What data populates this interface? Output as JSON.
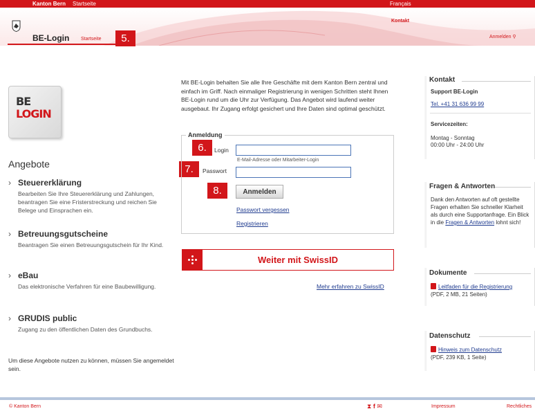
{
  "topbar": {
    "left_title": "Kanton Bern",
    "left_home": "Startseite",
    "language": "Français"
  },
  "header": {
    "kontakt": "Kontakt",
    "anmelden": "Anmelden",
    "brand": "BE-Login",
    "startseite": "Startseite"
  },
  "steps": {
    "s5": "5.",
    "s6": "6.",
    "s7": "7.",
    "s8": "8."
  },
  "logo": {
    "line1": "BE",
    "line2": "LOGIN"
  },
  "left": {
    "angebote_title": "Angebote",
    "offers": [
      {
        "title": "Steuererklärung",
        "desc": "Bearbeiten Sie Ihre Steuererklärung und Zahlungen, beantragen Sie eine Fristerstreckung und reichen Sie Belege und Einsprachen ein."
      },
      {
        "title": "Betreuungsgutscheine",
        "desc": "Beantragen Sie einen Betreuungsgutschein für Ihr Kind."
      },
      {
        "title": "eBau",
        "desc": "Das elektronische Verfahren für eine Baubewilligung."
      },
      {
        "title": "GRUDIS public",
        "desc": "Zugang zu den öffentlichen Daten des Grundbuchs."
      }
    ],
    "footnote": "Um diese Angebote nutzen zu können, müssen Sie angemeldet sein."
  },
  "main": {
    "intro": "Mit BE-Login behalten Sie alle Ihre Geschäfte mit dem Kanton Bern zentral und einfach im Griff. Nach einmaliger Registrierung in wenigen Schritten steht Ihnen BE-Login rund um die Uhr zur Verfügung. Das Angebot wird laufend weiter ausgebaut. Ihr Zugang erfolgt gesichert und Ihre Daten sind optimal geschützt.",
    "legend": "Anmeldung",
    "login_label": "Login",
    "login_value": "",
    "login_hint": "E-Mail-Adresse oder Mitarbeiter-Login",
    "password_label": "Passwort",
    "password_value": "",
    "submit": "Anmelden",
    "forgot": "Passwort vergessen",
    "register": "Registrieren",
    "swissid": "Weiter mit SwissID",
    "swissid_more": "Mehr erfahren zu SwissID"
  },
  "right": {
    "kontakt": {
      "title": "Kontakt",
      "support": "Support BE-Login",
      "phone": "Tel. +41 31 636 99 99",
      "service_title": "Servicezeiten:",
      "service_days": "Montag - Sonntag",
      "service_hours": "00:00 Uhr - 24:00 Uhr"
    },
    "faq": {
      "title": "Fragen & Antworten",
      "text": "Dank den Antworten auf oft gestellte Fragen erhalten Sie schneller Klarheit als durch eine Supportanfrage. Ein Blick in die",
      "link": "Fragen & Antworten",
      "text_end": "lohnt sich!"
    },
    "dokumente": {
      "title": "Dokumente",
      "link": "Leitfaden für die Registrierung",
      "meta": "(PDF, 2 MB, 21 Seiten)"
    },
    "datenschutz": {
      "title": "Datenschutz",
      "link": "Hinweis zum Datenschutz",
      "meta": "(PDF, 239 KB, 1 Seite)"
    }
  },
  "footer": {
    "copyright": "© Kanton Bern",
    "impressum": "Impressum",
    "rechtliches": "Rechtliches"
  },
  "colors": {
    "brand_red": "#d2161a",
    "link_blue": "#1f3b8f",
    "input_border": "#4a74b6"
  }
}
